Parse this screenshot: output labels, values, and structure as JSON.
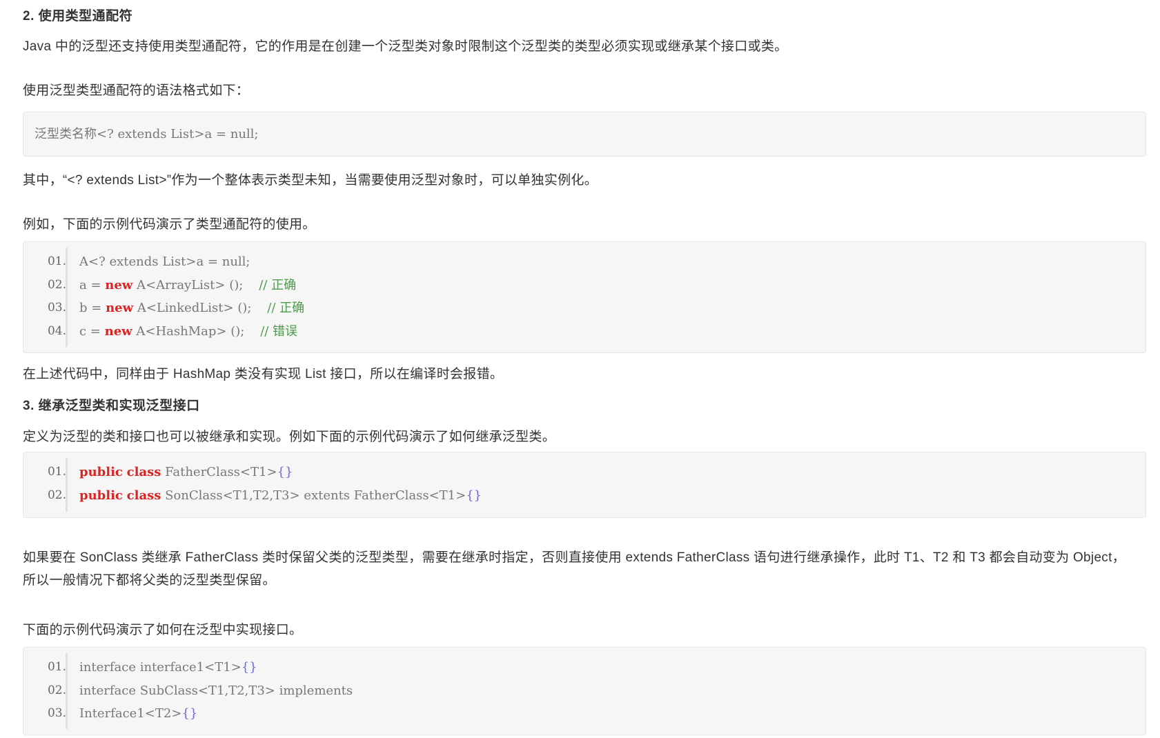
{
  "section2": {
    "heading": "2. 使用类型通配符",
    "intro": "Java 中的泛型还支持使用类型通配符，它的作用是在创建一个泛型类对象时限制这个泛型类的类型必须实现或继承某个接口或类。",
    "syntax_intro": "使用泛型类型通配符的语法格式如下：",
    "syntax_code": "泛型类名称<? extends List>a = null;",
    "explain": "其中，“<? extends List>”作为一个整体表示类型未知，当需要使用泛型对象时，可以单独实例化。",
    "example_intro": "例如，下面的示例代码演示了类型通配符的使用。",
    "code_lines": [
      {
        "num": "01.",
        "parts": [
          {
            "t": "A<? extends List>a = null;",
            "c": ""
          }
        ]
      },
      {
        "num": "02.",
        "parts": [
          {
            "t": "a = ",
            "c": ""
          },
          {
            "t": "new",
            "c": "kw"
          },
          {
            "t": " A<ArrayList> ();    ",
            "c": ""
          },
          {
            "t": "// 正确",
            "c": "cm"
          }
        ]
      },
      {
        "num": "03.",
        "parts": [
          {
            "t": "b = ",
            "c": ""
          },
          {
            "t": "new",
            "c": "kw"
          },
          {
            "t": " A<LinkedList> ();    ",
            "c": ""
          },
          {
            "t": "// 正确",
            "c": "cm"
          }
        ]
      },
      {
        "num": "04.",
        "parts": [
          {
            "t": "c = ",
            "c": ""
          },
          {
            "t": "new",
            "c": "kw"
          },
          {
            "t": " A<HashMap> ();    ",
            "c": ""
          },
          {
            "t": "// 错误",
            "c": "cm"
          }
        ]
      }
    ],
    "after_code": "在上述代码中，同样由于 HashMap 类没有实现 List 接口，所以在编译时会报错。"
  },
  "section3": {
    "heading": "3. 继承泛型类和实现泛型接口",
    "intro": "定义为泛型的类和接口也可以被继承和实现。例如下面的示例代码演示了如何继承泛型类。",
    "code1_lines": [
      {
        "num": "01.",
        "parts": [
          {
            "t": "public",
            "c": "kw"
          },
          {
            "t": " ",
            "c": ""
          },
          {
            "t": "class",
            "c": "kw"
          },
          {
            "t": " FatherClass<T1>",
            "c": ""
          },
          {
            "t": "{}",
            "c": "pu"
          }
        ]
      },
      {
        "num": "02.",
        "parts": [
          {
            "t": "public",
            "c": "kw"
          },
          {
            "t": " ",
            "c": ""
          },
          {
            "t": "class",
            "c": "kw"
          },
          {
            "t": " SonClass<T1,T2,T3> extents FatherClass<T1>",
            "c": ""
          },
          {
            "t": "{}",
            "c": "pu"
          }
        ]
      }
    ],
    "explain": "如果要在 SonClass 类继承 FatherClass 类时保留父类的泛型类型，需要在继承时指定，否则直接使用 extends FatherClass 语句进行继承操作，此时 T1、T2 和 T3 都会自动变为 Object，所以一般情况下都将父类的泛型类型保留。",
    "example_intro": "下面的示例代码演示了如何在泛型中实现接口。",
    "code2_lines": [
      {
        "num": "01.",
        "parts": [
          {
            "t": "interface interface1<T1>",
            "c": ""
          },
          {
            "t": "{}",
            "c": "pu"
          }
        ]
      },
      {
        "num": "02.",
        "parts": [
          {
            "t": "interface SubClass<T1,T2,T3> implements",
            "c": ""
          }
        ]
      },
      {
        "num": "03.",
        "parts": [
          {
            "t": "Interface1<T2>",
            "c": ""
          },
          {
            "t": "{}",
            "c": "pu"
          }
        ]
      }
    ]
  }
}
